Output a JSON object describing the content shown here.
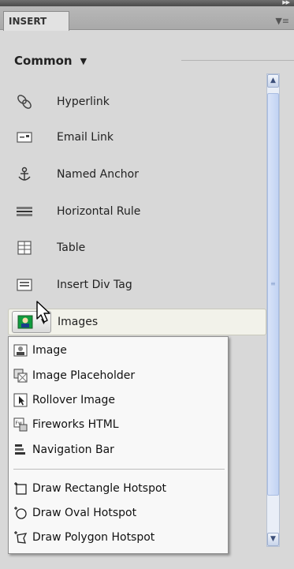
{
  "panel": {
    "tab_label": "INSERT",
    "category": "Common"
  },
  "items": [
    {
      "label": "Hyperlink",
      "icon": "hyperlink-icon"
    },
    {
      "label": "Email Link",
      "icon": "email-link-icon"
    },
    {
      "label": "Named Anchor",
      "icon": "named-anchor-icon"
    },
    {
      "label": "Horizontal Rule",
      "icon": "horizontal-rule-icon"
    },
    {
      "label": "Table",
      "icon": "table-icon"
    },
    {
      "label": "Insert Div Tag",
      "icon": "div-tag-icon"
    }
  ],
  "images": {
    "label": "Images",
    "icon": "image-icon"
  },
  "menu": [
    {
      "label": "Image",
      "icon": "image-icon"
    },
    {
      "label": "Image Placeholder",
      "icon": "image-placeholder-icon"
    },
    {
      "label": "Rollover Image",
      "icon": "rollover-image-icon"
    },
    {
      "label": "Fireworks HTML",
      "icon": "fireworks-html-icon"
    },
    {
      "label": "Navigation Bar",
      "icon": "navigation-bar-icon"
    },
    {
      "label": "Draw Rectangle Hotspot",
      "icon": "rectangle-hotspot-icon"
    },
    {
      "label": "Draw Oval Hotspot",
      "icon": "oval-hotspot-icon"
    },
    {
      "label": "Draw Polygon Hotspot",
      "icon": "polygon-hotspot-icon"
    }
  ],
  "colors": {
    "panel_bg": "#d8d8d8",
    "scroll_accent": "#c2d3f3",
    "highlight_row": "#f2f2ea"
  }
}
